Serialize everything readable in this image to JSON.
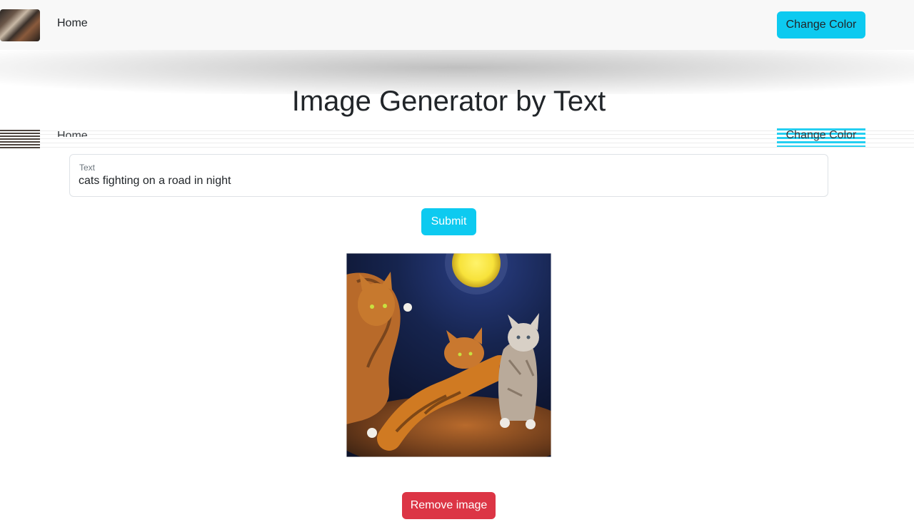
{
  "nav": {
    "home_label": "Home",
    "change_color_label": "Change Color"
  },
  "page": {
    "title": "Image Generator by Text"
  },
  "form": {
    "text_label": "Text",
    "text_value": "cats fighting on a road in night",
    "submit_label": "Submit"
  },
  "result": {
    "remove_label": "Remove image"
  },
  "colors": {
    "info": "#0dcaf0",
    "danger": "#dc3545",
    "navbar_bg": "#f8f8f8"
  }
}
